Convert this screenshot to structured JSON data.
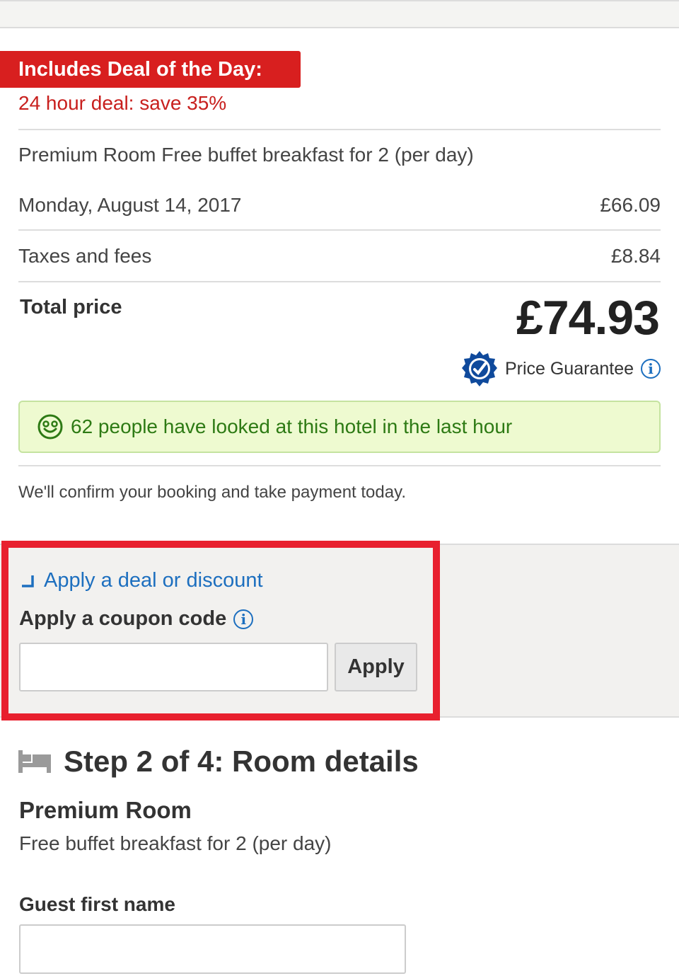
{
  "deal": {
    "banner_label": "Includes Deal of the Day:",
    "subtext": "24 hour deal: save 35%"
  },
  "summary": {
    "room_line": "Premium Room Free buffet breakfast for 2 (per day)",
    "date_label": "Monday, August 14, 2017",
    "date_price": "£66.09",
    "taxes_label": "Taxes and fees",
    "taxes_price": "£8.84",
    "total_label": "Total price",
    "total_price": "£74.93",
    "guarantee_label": "Price Guarantee"
  },
  "social_proof": {
    "text": "62 people have looked at this hotel in the last hour"
  },
  "confirm_text": "We'll confirm your booking and take payment today.",
  "discount": {
    "link_label": "Apply a deal or discount",
    "coupon_label": "Apply a coupon code",
    "coupon_value": "",
    "apply_label": "Apply"
  },
  "step": {
    "heading": "Step 2 of 4: Room details",
    "room_name": "Premium Room",
    "room_desc": "Free buffet breakfast for 2 (per day)",
    "guest_first_name_label": "Guest first name",
    "guest_first_name_value": ""
  },
  "icons": {
    "guarantee": "price-guarantee-badge-icon",
    "info": "info-icon",
    "smiley": "smiley-icon",
    "collapse": "collapse-arrow-icon",
    "bed": "bed-icon"
  },
  "colors": {
    "deal_red": "#d81f1f",
    "highlight_red": "#e8202e",
    "link_blue": "#1d6fbf",
    "social_green_text": "#2d7a14",
    "social_green_bg": "#eefad0"
  }
}
